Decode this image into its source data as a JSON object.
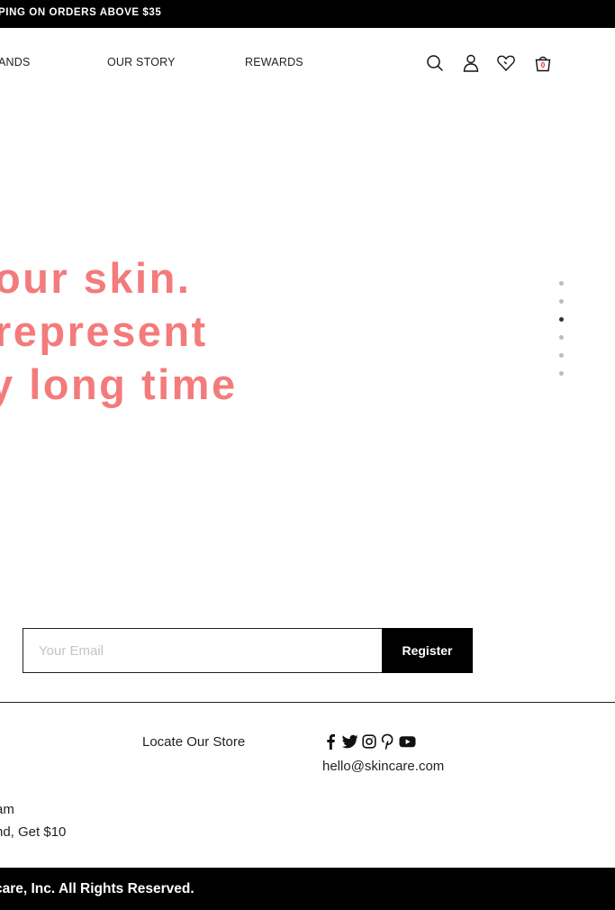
{
  "promo": {
    "text": "PING ON ORDERS ABOVE $35"
  },
  "nav": {
    "items": [
      {
        "label": "ANDS"
      },
      {
        "label": "OUR STORY"
      },
      {
        "label": "REWARDS"
      }
    ]
  },
  "header_icons": {
    "search": "search-icon",
    "account": "user-icon",
    "wishlist": "heart-icon",
    "cart": "shopping-bag-icon",
    "cart_count": "0"
  },
  "hero": {
    "lines": [
      "our skin.",
      "represent",
      "y long time"
    ],
    "color": "#f47b7b",
    "slide_count": 6,
    "active_slide": 3
  },
  "newsletter": {
    "placeholder": "Your Email",
    "value": "",
    "button_label": "Register"
  },
  "footer": {
    "locate_store": "Locate Our Store",
    "email": "hello@skincare.com",
    "social": [
      "facebook-icon",
      "twitter-icon",
      "instagram-icon",
      "pinterest-icon",
      "youtube-icon"
    ],
    "program_text": "am",
    "refer_text": "nd, Get $10",
    "copyright": "care, Inc. All Rights Reserved."
  }
}
